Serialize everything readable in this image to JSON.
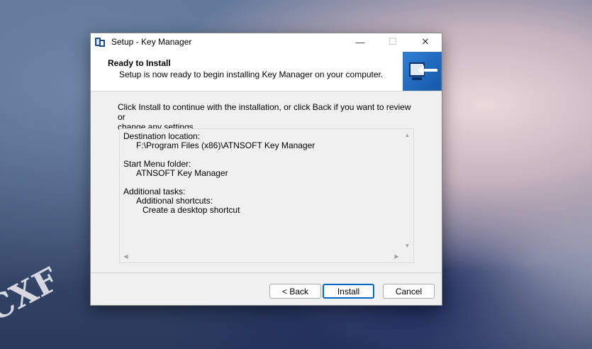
{
  "window": {
    "title": "Setup - Key Manager",
    "controls": {
      "minimize": "—",
      "maximize": "☐",
      "close": "✕"
    }
  },
  "header": {
    "title": "Ready to Install",
    "subtitle": "Setup is now ready to begin installing Key Manager on your computer."
  },
  "body": {
    "intro_line1": "Click Install to continue with the installation, or click Back if you want to review or",
    "intro_line2": "change any settings."
  },
  "memo": {
    "destination_label": "Destination location:",
    "destination_value": "F:\\Program Files (x86)\\ATNSOFT Key Manager",
    "start_menu_label": "Start Menu folder:",
    "start_menu_value": "ATNSOFT Key Manager",
    "tasks_label": "Additional tasks:",
    "shortcuts_label": "Additional shortcuts:",
    "shortcut_item": "Create a desktop shortcut",
    "scroll_up": "▲",
    "scroll_down": "▼",
    "scroll_left": "◀",
    "scroll_right": "▶"
  },
  "buttons": {
    "back": "< Back",
    "install": "Install",
    "cancel": "Cancel"
  },
  "wallpaper": {
    "text": "CXF"
  },
  "icons": {
    "app": "setup-app-icon",
    "wizard": "computer-install-icon"
  },
  "colors": {
    "default_button_border": "#0067c0",
    "wizard_image_bg": "#1f68c0"
  }
}
